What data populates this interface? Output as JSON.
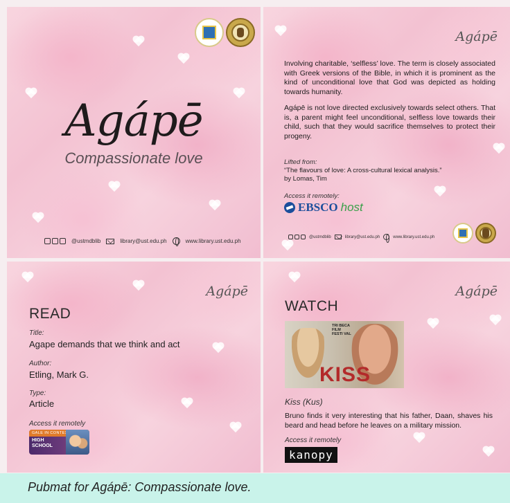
{
  "panel1": {
    "title": "Agápē",
    "subtitle": "Compassionate love",
    "footer": {
      "social": "@ustmdblib",
      "email": "library@ust.edu.ph",
      "website": "www.library.ust.edu.ph"
    }
  },
  "panel2": {
    "brand": "Agápē",
    "paragraph1": "Involving charitable, ‘selfless’ love. The term is closely associated with Greek versions of the Bible, in which it is prominent as the kind of unconditional love that God was depicted as holding towards humanity.",
    "paragraph2": "Agápē is not love directed exclusively towards select others. That is, a parent might feel unconditional, selfless love towards their child, such that they would sacrifice themselves to protect their progeny.",
    "lifted_label": "Lifted from:",
    "lifted_source": "“The flavours of love: A cross-cultural lexical analysis.”",
    "lifted_author": "by Lomas, Tim",
    "access_label": "Access it remotely:",
    "ebsco_main": "EBSCO",
    "ebsco_host": "host",
    "footer": {
      "social": "@ustmdblib",
      "email": "library@ust.edu.ph",
      "website": "www.library.ust.edu.ph"
    }
  },
  "panel3": {
    "brand": "Agápē",
    "section": "READ",
    "title_label": "Title:",
    "title_value": "Agape demands that we think and act",
    "author_label": "Author:",
    "author_value": "Etling, Mark G.",
    "type_label": "Type:",
    "type_value": "Article",
    "access_label": "Access it remotely",
    "gale_top": "GALE IN CONTEXT",
    "gale_line1": "HIGH",
    "gale_line2": "SCHOOL"
  },
  "panel4": {
    "brand": "Agápē",
    "section": "WATCH",
    "video_fest_1": "TRI BECA",
    "video_fest_2": "FILM",
    "video_fest_3": "FESTI VAL",
    "video_word": "KISS",
    "film_title": "Kiss (Kus)",
    "film_desc": "Bruno finds it very interesting that his father, Daan, shaves his beard and head before he leaves on a military mission.",
    "access_label": "Access it remotely",
    "kanopy": "kanopy"
  },
  "caption": "Pubmat for Agápē: Compassionate love."
}
